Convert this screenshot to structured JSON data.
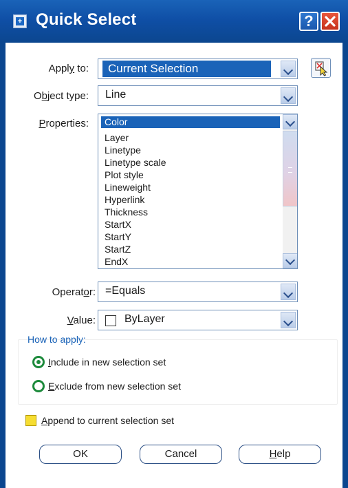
{
  "window": {
    "title": "Quick Select",
    "help_label": "?"
  },
  "apply_to": {
    "label_pre": "Appl",
    "label_key": "y",
    "label_post": " to:",
    "value": "Current Selection"
  },
  "object_type": {
    "label_pre": "O",
    "label_key": "b",
    "label_post": "ject type:",
    "value": "Line"
  },
  "properties": {
    "label_pre": "",
    "label_key": "P",
    "label_post": "roperties:",
    "selected_index": 0,
    "items": [
      "Color",
      "Layer",
      "Linetype",
      "Linetype scale",
      "Plot style",
      "Lineweight",
      "Hyperlink",
      "Thickness",
      "StartX",
      "StartY",
      "StartZ",
      "EndX"
    ]
  },
  "operator": {
    "label_pre": "Operat",
    "label_key": "o",
    "label_post": "r:",
    "value": "=Equals"
  },
  "value": {
    "label_pre": "",
    "label_key": "V",
    "label_post": "alue:",
    "value": "ByLayer"
  },
  "how_to_apply": {
    "legend": "How to apply:",
    "include_key": "I",
    "include_rest": "nclude in new selection set",
    "include_selected": true,
    "exclude_key": "E",
    "exclude_rest": "xclude from new selection set"
  },
  "append": {
    "key": "A",
    "rest": "ppend to current selection set",
    "checked": false
  },
  "buttons": {
    "ok": "OK",
    "cancel": "Cancel",
    "help_key": "H",
    "help_rest": "elp"
  },
  "colors": {
    "title_bar": "#1a63b8",
    "selection": "#1a63b8",
    "radio": "#1c8a3b",
    "checkbox": "#f6dd31",
    "close": "#c7321c"
  }
}
